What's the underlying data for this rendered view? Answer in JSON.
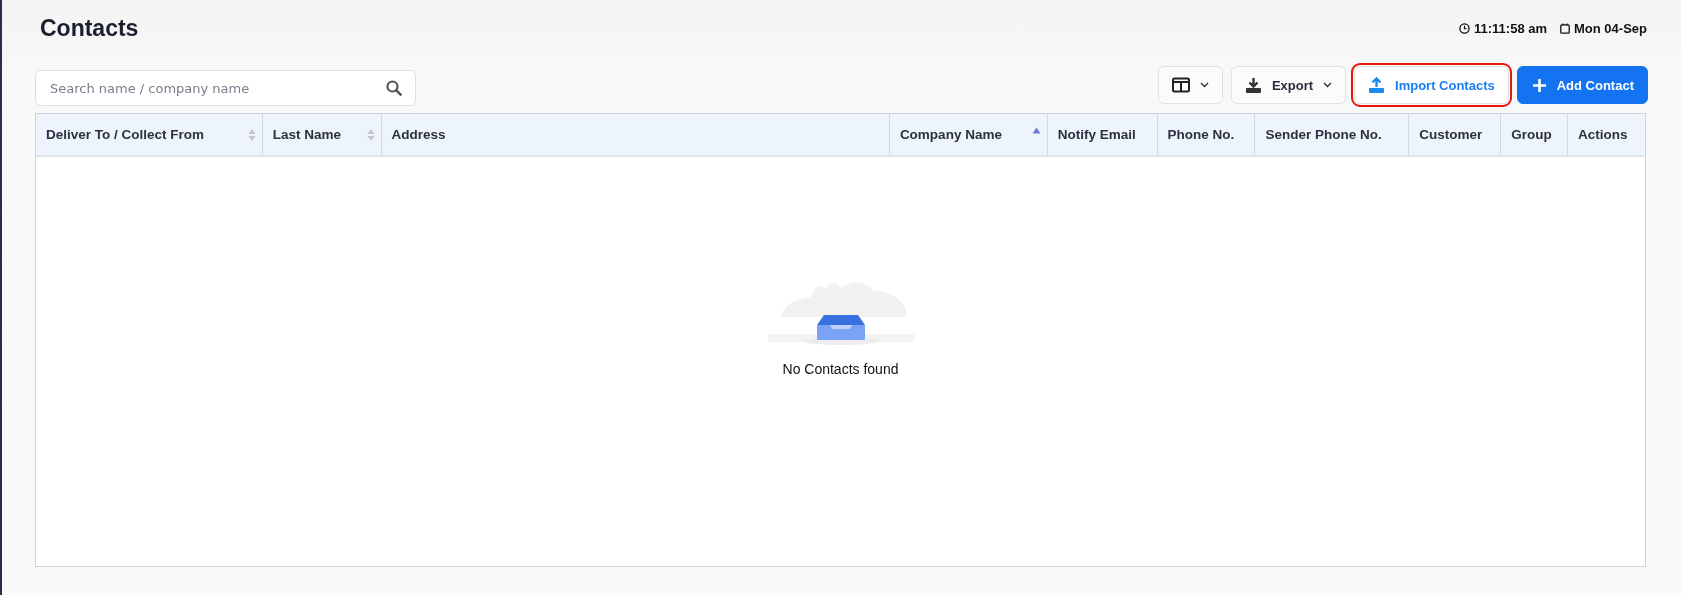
{
  "page": {
    "title": "Contacts",
    "time": "11:11:58 am",
    "date": "Mon 04-Sep"
  },
  "search": {
    "placeholder": "Search name / company name"
  },
  "toolbar": [
    {
      "kind": "columns",
      "highlighted": false
    },
    {
      "kind": "export",
      "label": "Export",
      "highlighted": false
    },
    {
      "kind": "import",
      "label": "Import Contacts",
      "highlighted": true
    },
    {
      "kind": "add",
      "label": "Add Contact",
      "highlighted": false
    }
  ],
  "table": {
    "columns": [
      {
        "label": "Deliver To / Collect From",
        "sortable": true,
        "sorted": false
      },
      {
        "label": "Last Name",
        "sortable": true,
        "sorted": false
      },
      {
        "label": "Address"
      },
      {
        "label": "Company Name",
        "sortable": true,
        "sorted": true
      },
      {
        "label": "Notify Email"
      },
      {
        "label": "Phone No."
      },
      {
        "label": "Sender Phone No."
      },
      {
        "label": "Customer"
      },
      {
        "label": "Group"
      },
      {
        "label": "Actions"
      }
    ],
    "empty_message": "No Contacts found"
  }
}
